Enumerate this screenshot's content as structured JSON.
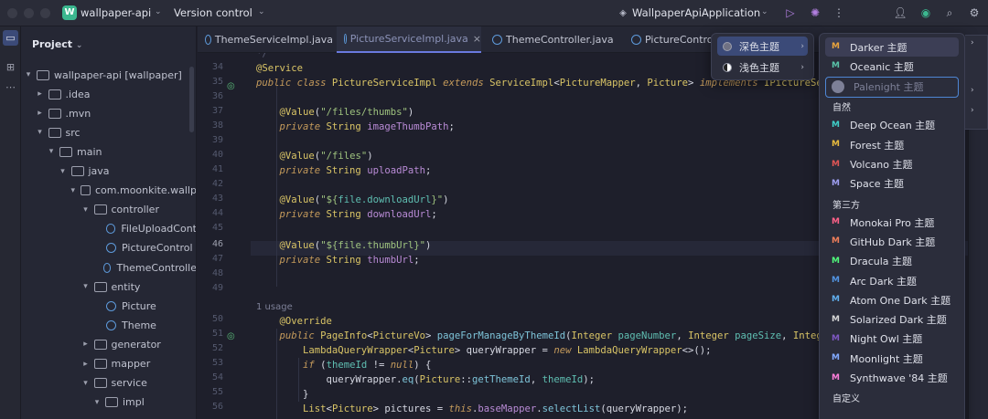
{
  "titlebar": {
    "project_badge": "W",
    "project_name": "wallpaper-api",
    "vcs_label": "Version control",
    "run_config": "WallpaperApiApplication"
  },
  "project_panel": {
    "title": "Project",
    "tree": [
      {
        "label": "wallpaper-api [wallpaper]",
        "depth": 0,
        "arrow": "▾",
        "icon": "folder"
      },
      {
        "label": ".idea",
        "depth": 1,
        "arrow": "▸",
        "icon": "folder"
      },
      {
        "label": ".mvn",
        "depth": 1,
        "arrow": "▸",
        "icon": "folder"
      },
      {
        "label": "src",
        "depth": 1,
        "arrow": "▾",
        "icon": "folder"
      },
      {
        "label": "main",
        "depth": 2,
        "arrow": "▾",
        "icon": "folder"
      },
      {
        "label": "java",
        "depth": 3,
        "arrow": "▾",
        "icon": "folder"
      },
      {
        "label": "com.moonkite.wallp",
        "depth": 4,
        "arrow": "▾",
        "icon": "folder"
      },
      {
        "label": "controller",
        "depth": 5,
        "arrow": "▾",
        "icon": "folder"
      },
      {
        "label": "FileUploadCont",
        "depth": 6,
        "arrow": "",
        "icon": "class"
      },
      {
        "label": "PictureControl",
        "depth": 6,
        "arrow": "",
        "icon": "class"
      },
      {
        "label": "ThemeControlle",
        "depth": 6,
        "arrow": "",
        "icon": "class"
      },
      {
        "label": "entity",
        "depth": 5,
        "arrow": "▾",
        "icon": "folder"
      },
      {
        "label": "Picture",
        "depth": 6,
        "arrow": "",
        "icon": "class"
      },
      {
        "label": "Theme",
        "depth": 6,
        "arrow": "",
        "icon": "class"
      },
      {
        "label": "generator",
        "depth": 5,
        "arrow": "▸",
        "icon": "folder"
      },
      {
        "label": "mapper",
        "depth": 5,
        "arrow": "▸",
        "icon": "folder"
      },
      {
        "label": "service",
        "depth": 5,
        "arrow": "▾",
        "icon": "folder"
      },
      {
        "label": "impl",
        "depth": 6,
        "arrow": "▾",
        "icon": "folder"
      }
    ]
  },
  "tabs": [
    {
      "label": "ThemeServiceImpl.java",
      "active": false
    },
    {
      "label": "PictureServiceImpl.java",
      "active": true
    },
    {
      "label": "ThemeController.java",
      "active": false
    },
    {
      "label": "PictureControl",
      "active": false
    }
  ],
  "editor": {
    "line_numbers": [
      "34",
      "35",
      "36",
      "37",
      "38",
      "39",
      "40",
      "41",
      "42",
      "43",
      "44",
      "45",
      "46",
      "47",
      "48",
      "49",
      "",
      "50",
      "51",
      "52",
      "53",
      "54",
      "55",
      "56"
    ],
    "usage_hint": "1 usage"
  },
  "theme_menu": {
    "items": [
      {
        "label": "深色主题",
        "selected": true
      },
      {
        "label": "浅色主题",
        "selected": false
      }
    ]
  },
  "theme_list": {
    "sections": [
      {
        "header": "",
        "items": [
          {
            "label": "Darker 主题",
            "color": "#e8a33d",
            "state": "selected"
          },
          {
            "label": "Oceanic 主题",
            "color": "#59c2a8",
            "state": "normal"
          },
          {
            "label": "Palenight 主题",
            "color": "#7d8097",
            "state": "focus"
          }
        ]
      },
      {
        "header": "自然",
        "items": [
          {
            "label": "Deep Ocean 主题",
            "color": "#3fd0c9",
            "state": "normal"
          },
          {
            "label": "Forest 主题",
            "color": "#e8bb3d",
            "state": "normal"
          },
          {
            "label": "Volcano 主题",
            "color": "#e05555",
            "state": "normal"
          },
          {
            "label": "Space 主题",
            "color": "#9e9ef0",
            "state": "normal"
          }
        ]
      },
      {
        "header": "第三方",
        "items": [
          {
            "label": "Monokai Pro 主题",
            "color": "#ff6188",
            "state": "normal"
          },
          {
            "label": "GitHub Dark 主题",
            "color": "#f07e5a",
            "state": "normal"
          },
          {
            "label": "Dracula 主题",
            "color": "#50fa7b",
            "state": "normal"
          },
          {
            "label": "Arc Dark 主题",
            "color": "#5294e2",
            "state": "normal"
          },
          {
            "label": "Atom One Dark 主题",
            "color": "#61afef",
            "state": "normal"
          },
          {
            "label": "Solarized Dark 主题",
            "color": "#d6d6d6",
            "state": "normal"
          },
          {
            "label": "Night Owl 主题",
            "color": "#7e57c2",
            "state": "normal"
          },
          {
            "label": "Moonlight 主题",
            "color": "#82aaff",
            "state": "normal"
          },
          {
            "label": "Synthwave '84 主题",
            "color": "#ff7edb",
            "state": "normal"
          }
        ]
      },
      {
        "header": "自定义",
        "items": []
      }
    ]
  }
}
